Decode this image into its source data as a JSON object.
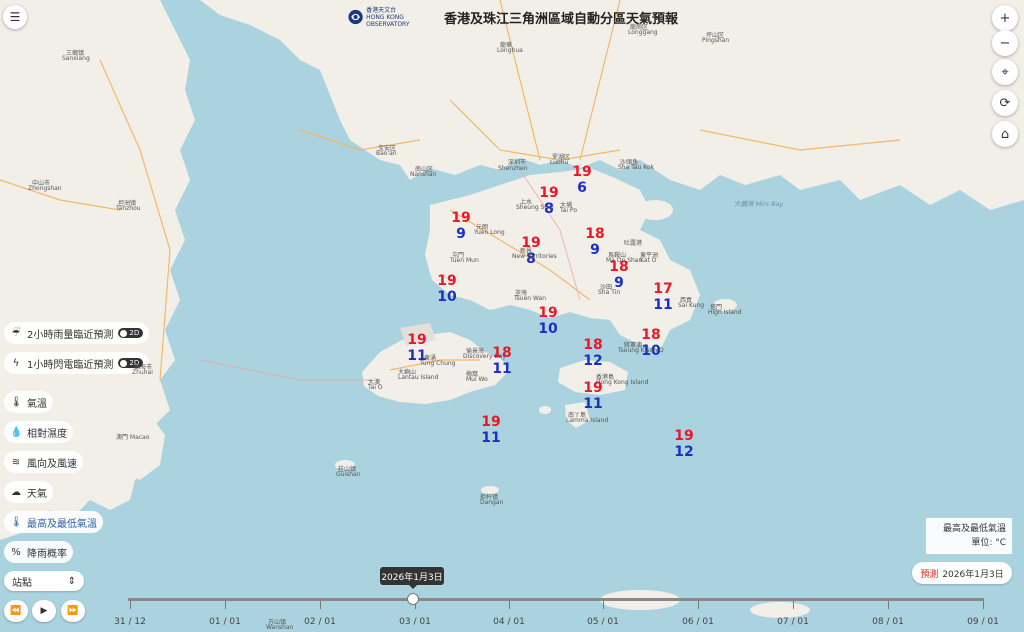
{
  "header": {
    "logo_cn": "香港天文台",
    "logo_en": "HONG KONG OBSERVATORY",
    "title": "香港及珠江三角洲區域自動分區天氣預報"
  },
  "colors": {
    "max_temp": "#e8182a",
    "min_temp": "#1b2fc8",
    "sea": "#aad3df",
    "land": "#f2efe9",
    "forecast_label": "#e02020"
  },
  "controls": {
    "menu_icon": "☰",
    "zoom_in": "+",
    "zoom_out": "−",
    "locate_icon": "⌖",
    "refresh_icon": "⟳",
    "home_icon": "⌂"
  },
  "layers": [
    {
      "name": "rain-nowcast",
      "icon": "☔",
      "label": "2小時雨量臨近預測",
      "toggle": "2D"
    },
    {
      "name": "lightning-nowcast",
      "icon": "ϟ",
      "label": "1小時閃電臨近預測",
      "toggle": "2D"
    },
    {
      "name": "temperature",
      "icon": "🌡",
      "label": "氣溫"
    },
    {
      "name": "humidity",
      "icon": "💧",
      "label": "相對濕度"
    },
    {
      "name": "wind",
      "icon": "≋",
      "label": "風向及風速"
    },
    {
      "name": "weather",
      "icon": "☁",
      "label": "天氣"
    },
    {
      "name": "max-min-temp",
      "icon": "🌡",
      "label": "最高及最低氣溫",
      "active": true
    },
    {
      "name": "rain-probability",
      "icon": "%",
      "label": "降雨概率"
    }
  ],
  "station_select": {
    "label": "站點",
    "arrow": "⇕"
  },
  "playback": {
    "rewind": "⏪",
    "play": "▶",
    "forward": "⏩"
  },
  "legend": {
    "line1": "最高及最低氣溫",
    "line2": "單位: °C"
  },
  "forecast": {
    "label": "預測",
    "date": "2026年1月3日"
  },
  "timeline": {
    "tooltip": "2026年1月3日",
    "ticks": [
      "31 / 12",
      "01 / 01",
      "02 / 01",
      "03 / 01",
      "04 / 01",
      "05 / 01",
      "06 / 01",
      "07 / 01",
      "08 / 01",
      "09 / 01"
    ]
  },
  "stations": [
    {
      "max": "19",
      "min": "6"
    },
    {
      "max": "19",
      "min": "8"
    },
    {
      "max": "19",
      "min": "9"
    },
    {
      "max": "18",
      "min": "9"
    },
    {
      "max": "19",
      "min": "8"
    },
    {
      "max": "18",
      "min": "9"
    },
    {
      "max": "19",
      "min": "10"
    },
    {
      "max": "17",
      "min": "11"
    },
    {
      "max": "19",
      "min": "10"
    },
    {
      "max": "19",
      "min": "11"
    },
    {
      "max": "18",
      "min": "10"
    },
    {
      "max": "18",
      "min": "11"
    },
    {
      "max": "18",
      "min": "12"
    },
    {
      "max": "19",
      "min": "11"
    },
    {
      "max": "19",
      "min": "11"
    },
    {
      "max": "19",
      "min": "12"
    }
  ],
  "places": [
    "中山市",
    "Zhongshan",
    "珠海市",
    "Zhuhai",
    "澳門 Macao",
    "深圳市",
    "Shenzhen",
    "南山区",
    "Nanshan",
    "宝安区",
    "Bao'an",
    "罗湖区",
    "Luohu",
    "大鵬灣 Mirs Bay",
    "香港島",
    "Hong Kong Island",
    "大嶼山",
    "Lantau Island",
    "南丫島",
    "Lamma Island",
    "桂山镇",
    "Guishan",
    "担杆镇",
    "Dangan",
    "万山镇",
    "Wanshan",
    "龍華",
    "Longhua",
    "龍崗区",
    "Longgang",
    "坪山区",
    "Pingshan",
    "沙頭角",
    "Sha Tau Kok",
    "東涌",
    "Tung Chung",
    "大澳",
    "Tai O",
    "梅窩",
    "Mui Wo",
    "愉景灣",
    "Discovery Bay",
    "新界",
    "New Territories",
    "吐露港",
    "西貢",
    "Sai Kung",
    "將軍澳",
    "Tseung Kwan O",
    "荃灣",
    "Tsuen Wan",
    "沙田",
    "Sha Tin",
    "屯門",
    "Tuen Mun",
    "元朗",
    "Yuen Long",
    "上水",
    "Sheung Shui",
    "大埔",
    "Tai Po",
    "馬鞍山",
    "Ma On Shan",
    "東平洲",
    "Kat O",
    "塔門",
    "High Island",
    "三鄉镇",
    "Sanxiang",
    "坦洲镇",
    "Tanzhou"
  ]
}
